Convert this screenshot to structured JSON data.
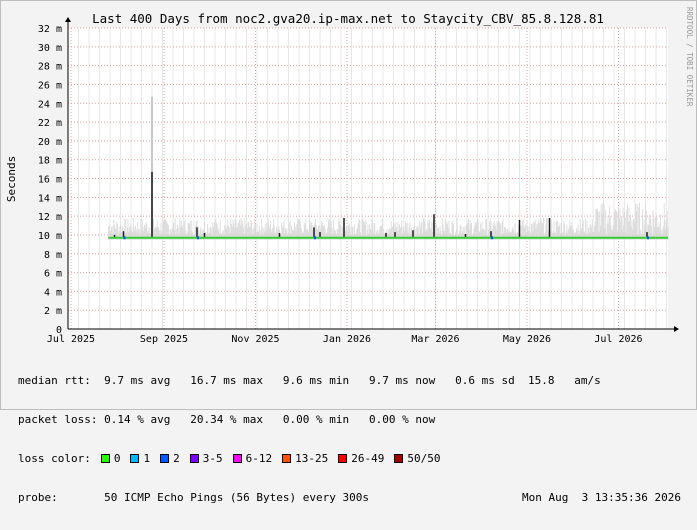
{
  "chart_data": {
    "type": "line",
    "title": "Last 400 Days from noc2.gva20.ip-max.net to Staycity_CBV_85.8.128.81",
    "ylabel": "Seconds",
    "side_label": "RRDTOOL / TOBI OETIKER",
    "ylim": [
      0,
      32
    ],
    "y_unit": "m",
    "y_ticks": [
      "0",
      "2 m",
      "4 m",
      "6 m",
      "8 m",
      "10 m",
      "12 m",
      "14 m",
      "16 m",
      "18 m",
      "20 m",
      "22 m",
      "24 m",
      "26 m",
      "28 m",
      "30 m",
      "32 m"
    ],
    "x_ticks": [
      "Jul 2025",
      "Sep 2025",
      "Nov 2025",
      "Jan 2026",
      "Mar 2026",
      "May 2026",
      "Jul 2026"
    ],
    "x_range": [
      "2025-06-29",
      "2026-08-03"
    ],
    "data_start": "2025-07-26",
    "series": [
      {
        "name": "median rtt",
        "color": "#33cc33",
        "baseline_ms": 9.7,
        "spikes": [
          {
            "date": "2025-07-30",
            "value_ms": 10.0
          },
          {
            "date": "2025-08-05",
            "value_ms": 10.4
          },
          {
            "date": "2025-08-24",
            "value_ms": 16.7
          },
          {
            "date": "2025-09-23",
            "value_ms": 10.8
          },
          {
            "date": "2025-09-28",
            "value_ms": 10.2
          },
          {
            "date": "2025-11-17",
            "value_ms": 10.2
          },
          {
            "date": "2025-12-10",
            "value_ms": 10.8
          },
          {
            "date": "2025-12-14",
            "value_ms": 10.3
          },
          {
            "date": "2025-12-30",
            "value_ms": 11.8
          },
          {
            "date": "2026-01-27",
            "value_ms": 10.2
          },
          {
            "date": "2026-02-02",
            "value_ms": 10.3
          },
          {
            "date": "2026-02-14",
            "value_ms": 10.5
          },
          {
            "date": "2026-02-28",
            "value_ms": 12.2
          },
          {
            "date": "2026-03-21",
            "value_ms": 10.1
          },
          {
            "date": "2026-04-07",
            "value_ms": 10.4
          },
          {
            "date": "2026-04-26",
            "value_ms": 11.6
          },
          {
            "date": "2026-05-16",
            "value_ms": 11.8
          },
          {
            "date": "2026-07-20",
            "value_ms": 10.3
          }
        ]
      }
    ],
    "smoke_color": "#d8d8d8",
    "grid": true,
    "legend": "bottom"
  },
  "stats": {
    "rows": [
      {
        "label": "median rtt:",
        "value": "  9.7 ms avg   16.7 ms max   9.6 ms min   9.7 ms now   0.6 ms sd  15.8   am/s"
      },
      {
        "label": "packet loss:",
        "value": " 0.14 % avg   20.34 % max   0.00 % min   0.00 % now"
      }
    ],
    "loss_label": "loss color:",
    "loss_colors": [
      {
        "label": "0",
        "color": "#26ff00"
      },
      {
        "label": "1",
        "color": "#00b8ff"
      },
      {
        "label": "2",
        "color": "#0059ff"
      },
      {
        "label": "3-5",
        "color": "#7e00ff"
      },
      {
        "label": "6-12",
        "color": "#ff00ff"
      },
      {
        "label": "13-25",
        "color": "#ff5500"
      },
      {
        "label": "26-49",
        "color": "#ff0000"
      },
      {
        "label": "50/50",
        "color": "#a10000"
      }
    ],
    "probe_label": "probe:",
    "probe_value": "       50 ICMP Echo Pings (56 Bytes) every 300s",
    "probe_date": "Mon Aug  3 13:35:36 2026"
  }
}
